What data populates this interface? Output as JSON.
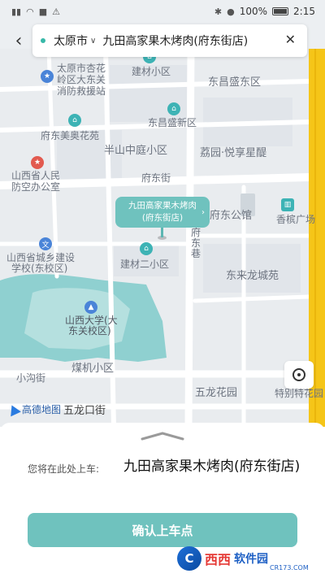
{
  "status_bar": {
    "time": "2:15",
    "battery": "100%"
  },
  "search": {
    "city": "太原市",
    "query": "九田高家果木烤肉(府东街店)"
  },
  "map": {
    "labels": {
      "l1": "太原市杏花",
      "l2": "岭区大东关",
      "l3": "消防救援站",
      "l4": "建材小区",
      "l5": "东昌盛东区",
      "l6": "东昌盛新区",
      "l7": "府东美奥花苑",
      "l8": "半山中庭小区",
      "l9": "荔园·悦享星醍",
      "l10": "山西省人民",
      "l11": "防空办公室",
      "l12": "府东街",
      "l13": "府东公馆",
      "l14": "香槟广场",
      "l15": "府东巷",
      "l16": "山西省城乡建设",
      "l17": "学校(东校区)",
      "l18": "建材二小区",
      "l19": "东来龙城苑",
      "l20": "山西大学(大",
      "l21": "东关校区)",
      "l22": "煤机小区",
      "l23": "小沟街",
      "l24": "五龙花园",
      "l25": "特别特花园",
      "l26": "五龙口街"
    },
    "pin": {
      "line1": "九田高家果木烤肉",
      "line2": "(府东街店)"
    },
    "attribution": "高德地图"
  },
  "sheet": {
    "prompt": "您将在此处上车:",
    "pickup_name": "九田高家果木烤肉(府东街店)",
    "confirm_label": "确认上车点"
  },
  "watermark": {
    "logo_letter": "C",
    "brand_red": "西西",
    "brand_blue": "软件园",
    "domain": "CR173.COM"
  },
  "colors": {
    "accent": "#6fc2be",
    "road_yellow": "#f5c518",
    "water": "#8fd0d0"
  }
}
